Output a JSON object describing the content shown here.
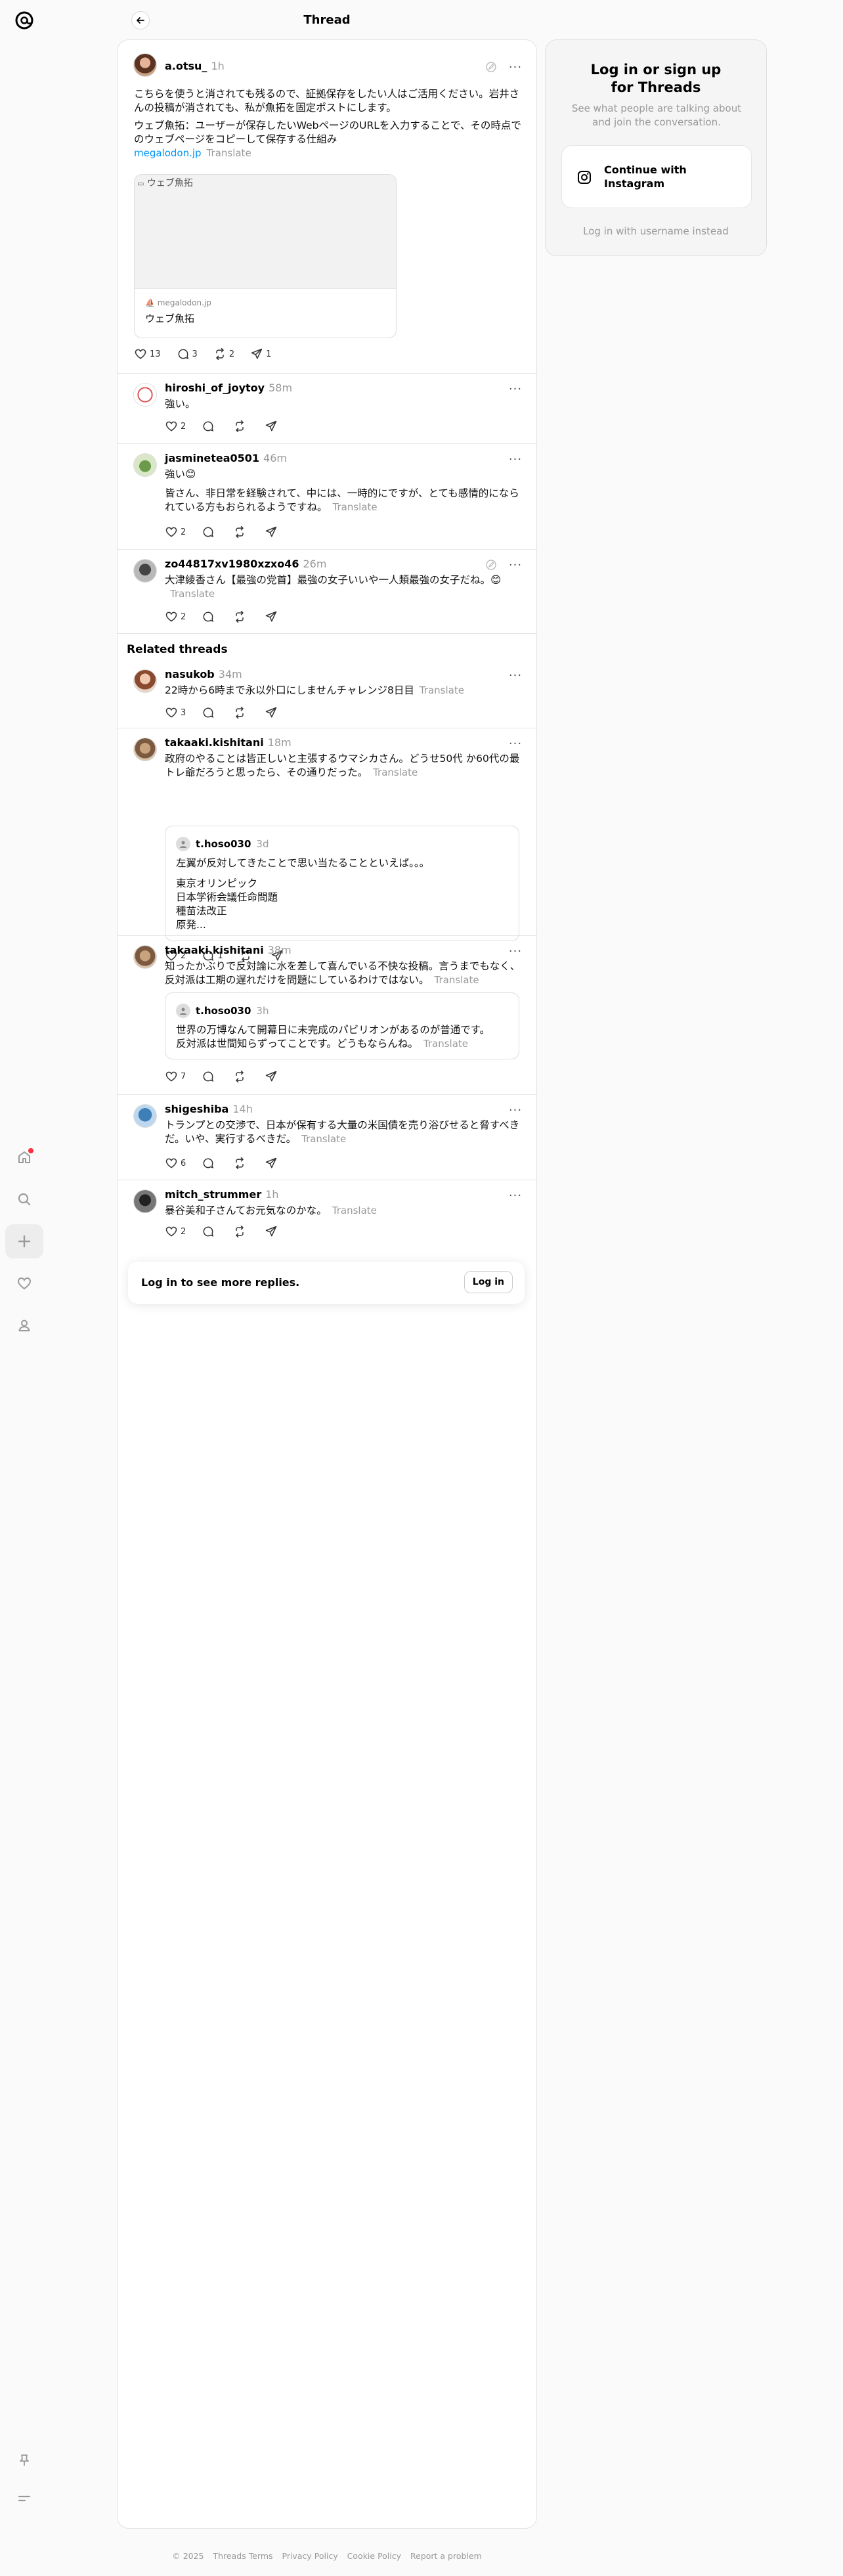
{
  "header": {
    "title": "Thread"
  },
  "main_post": {
    "username": "a.otsu_",
    "time": "1h",
    "paragraph1": "こちらを使うと消されても残るので、証拠保存をしたい人はご活用ください。岩井さんの投稿が消されても、私が魚拓を固定ポストにします。",
    "paragraph2": "ウェブ魚拓：ユーザーが保存したいWebページのURLを入力することで、その時点でのウェブページをコピーして保存する仕組み",
    "link": "megalodon.jp",
    "translate": "Translate",
    "card_alt": "ウェブ魚拓",
    "card_domain": "megalodon.jp",
    "card_title": "ウェブ魚拓",
    "likes": "13",
    "replies": "3",
    "reposts": "2",
    "shares": "1"
  },
  "replies": [
    {
      "username": "hiroshi_of_joytoy",
      "time": "58m",
      "text": "強い。",
      "likes": "2"
    },
    {
      "username": "jasminetea0501",
      "time": "46m",
      "text": "強い😊",
      "text2": "皆さん、非日常を経験されて、中には、一時的にですが、とても感情的になられている方もおられるようですね。",
      "translate": "Translate",
      "likes": "2"
    },
    {
      "username": "zo44817xv1980xzxo46",
      "time": "26m",
      "text": "大津綾香さん【最強の党首】最強の女子いいや一人類最強の女子だね。😊",
      "translate": "Translate",
      "likes": "2"
    }
  ],
  "related_title": "Related threads",
  "related": [
    {
      "username": "nasukob",
      "time": "34m",
      "text": "22時から6時まで永以外口にしませんチャレンジ8日目",
      "translate": "Translate",
      "likes": "3"
    },
    {
      "username": "takaaki.kishitani",
      "time": "18m",
      "text": "政府のやることは皆正しいと主張するウマシカさん。どうせ50代 か60代の最トレ爺だろうと思ったら、その通りだった。",
      "translate": "Translate",
      "likes": "2",
      "replies": "1",
      "quote": {
        "username": "t.hoso030",
        "time": "3d",
        "line1": "左翼が反対してきたことで思い当たることといえば。。。",
        "items": [
          "東京オリンピック",
          "日本学術会議任命問題",
          "種苗法改正",
          "原発..."
        ]
      }
    },
    {
      "username": "takaaki.kishitani",
      "time": "38m",
      "text": "知ったかぶりで反対論に水を差して喜んでいる不快な投稿。言うまでもなく、反対派は工期の遅れだけを問題にしているわけではない。",
      "translate": "Translate",
      "likes": "7",
      "quote": {
        "username": "t.hoso030",
        "time": "3h",
        "line1": "世界の万博なんて開幕日に未完成のパビリオンがあるのが普通です。",
        "line2": "反対派は世間知らずってことです。どうもならんね。",
        "translate": "Translate"
      }
    },
    {
      "username": "shigeshiba",
      "time": "14h",
      "text": "トランプとの交渉で、日本が保有する大量の米国債を売り浴びせると脅すべきだ。いや、実行するべきだ。",
      "translate": "Translate",
      "likes": "6"
    },
    {
      "username": "mitch_strummer",
      "time": "1h",
      "text": "暴谷美和子さんてお元気なのかな。",
      "translate": "Translate",
      "likes": "2"
    }
  ],
  "login_banner": {
    "text": "Log in to see more replies.",
    "button": "Log in"
  },
  "sidebar_card": {
    "title": "Log in or sign up for Threads",
    "subtitle": "See what people are talking about and join the conversation.",
    "instagram_button": "Continue with Instagram",
    "alt_login": "Log in with username instead"
  },
  "footer": {
    "copyright": "© 2025",
    "links": [
      "Threads Terms",
      "Privacy Policy",
      "Cookie Policy",
      "Report a problem"
    ]
  },
  "colors": {
    "accent_link": "#0095f6",
    "notification": "#ff3040",
    "muted": "#999999"
  }
}
